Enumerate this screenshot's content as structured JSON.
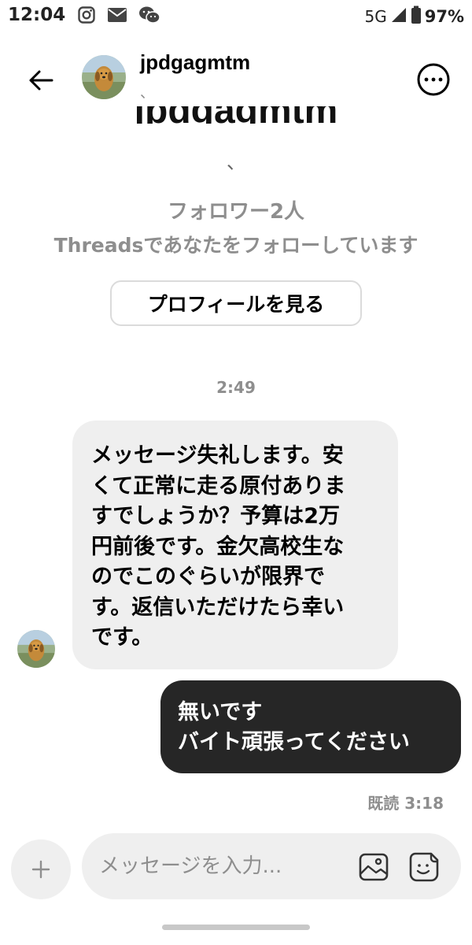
{
  "status_bar": {
    "time": "12:04",
    "network": "5G",
    "battery": "97%",
    "left_icons": [
      "instagram-icon",
      "mail-icon",
      "wechat-icon"
    ]
  },
  "header": {
    "username": "jpdgagmtm",
    "sub": "、"
  },
  "profile": {
    "name_clipped": "jpdgagmtm",
    "mark": "、",
    "followers": "フォロワー2人",
    "threads_follow": "Threadsであなたをフォローしています",
    "view_profile_label": "プロフィールを見る"
  },
  "conversation": {
    "time_label": "2:49",
    "incoming_message": "メッセージ失礼します。安\nくて正常に走る原付ありま\nすでしょうか？予算は2万\n円前後です。金欠高校生な\nのでこのぐらいが限界で\nす。返信いただけたら幸い\nです。",
    "outgoing_message": "無いです\nバイト頑張ってください",
    "read_receipt": "既読 3:18"
  },
  "composer": {
    "placeholder": "メッセージを入力..."
  },
  "colors": {
    "incoming_bubble": "#efefef",
    "outgoing_bubble": "#262626",
    "muted_text": "#8e8e8e"
  }
}
